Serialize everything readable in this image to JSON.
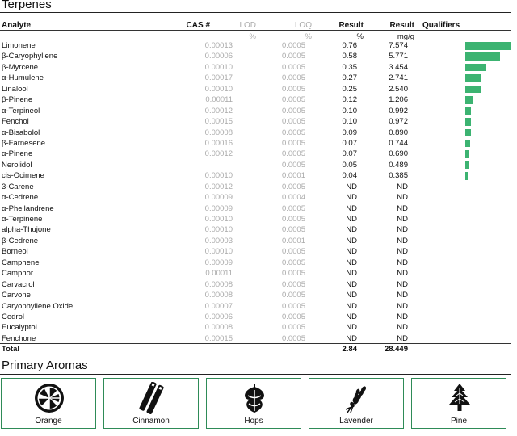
{
  "section_title": "Terpenes",
  "headers": {
    "analyte": "Analyte",
    "cas": "CAS #",
    "lod": "LOD",
    "loq": "LOQ",
    "result_pct": "Result",
    "result_mg": "Result",
    "qualifiers": "Qualifiers"
  },
  "units": {
    "lod": "%",
    "loq": "%",
    "result_pct": "%",
    "result_mg": "mg/g"
  },
  "rows": [
    {
      "name": "Limonene",
      "lod": "0.00013",
      "loq": "0.0005",
      "pct": "0.76",
      "mg": "7.574",
      "bar": 1.0
    },
    {
      "name": "β-Caryophyllene",
      "lod": "0.00006",
      "loq": "0.0005",
      "pct": "0.58",
      "mg": "5.771",
      "bar": 0.76
    },
    {
      "name": "β-Myrcene",
      "lod": "0.00010",
      "loq": "0.0005",
      "pct": "0.35",
      "mg": "3.454",
      "bar": 0.46
    },
    {
      "name": "α-Humulene",
      "lod": "0.00017",
      "loq": "0.0005",
      "pct": "0.27",
      "mg": "2.741",
      "bar": 0.36
    },
    {
      "name": "Linalool",
      "lod": "0.00010",
      "loq": "0.0005",
      "pct": "0.25",
      "mg": "2.540",
      "bar": 0.34
    },
    {
      "name": "β-Pinene",
      "lod": "0.00011",
      "loq": "0.0005",
      "pct": "0.12",
      "mg": "1.206",
      "bar": 0.16
    },
    {
      "name": "α-Terpineol",
      "lod": "0.00012",
      "loq": "0.0005",
      "pct": "0.10",
      "mg": "0.992",
      "bar": 0.13
    },
    {
      "name": "Fenchol",
      "lod": "0.00015",
      "loq": "0.0005",
      "pct": "0.10",
      "mg": "0.972",
      "bar": 0.13
    },
    {
      "name": "α-Bisabolol",
      "lod": "0.00008",
      "loq": "0.0005",
      "pct": "0.09",
      "mg": "0.890",
      "bar": 0.12
    },
    {
      "name": "β-Farnesene",
      "lod": "0.00016",
      "loq": "0.0005",
      "pct": "0.07",
      "mg": "0.744",
      "bar": 0.1
    },
    {
      "name": "α-Pinene",
      "lod": "0.00012",
      "loq": "0.0005",
      "pct": "0.07",
      "mg": "0.690",
      "bar": 0.09
    },
    {
      "name": "Nerolidol",
      "lod": "",
      "loq": "0.0005",
      "pct": "0.05",
      "mg": "0.489",
      "bar": 0.065
    },
    {
      "name": "cis-Ocimene",
      "lod": "0.00010",
      "loq": "0.0001",
      "pct": "0.04",
      "mg": "0.385",
      "bar": 0.05
    },
    {
      "name": "3-Carene",
      "lod": "0.00012",
      "loq": "0.0005",
      "pct": "ND",
      "mg": "ND",
      "bar": 0
    },
    {
      "name": "α-Cedrene",
      "lod": "0.00009",
      "loq": "0.0004",
      "pct": "ND",
      "mg": "ND",
      "bar": 0
    },
    {
      "name": "α-Phellandrene",
      "lod": "0.00009",
      "loq": "0.0005",
      "pct": "ND",
      "mg": "ND",
      "bar": 0
    },
    {
      "name": "α-Terpinene",
      "lod": "0.00010",
      "loq": "0.0005",
      "pct": "ND",
      "mg": "ND",
      "bar": 0
    },
    {
      "name": "alpha-Thujone",
      "lod": "0.00010",
      "loq": "0.0005",
      "pct": "ND",
      "mg": "ND",
      "bar": 0
    },
    {
      "name": "β-Cedrene",
      "lod": "0.00003",
      "loq": "0.0001",
      "pct": "ND",
      "mg": "ND",
      "bar": 0
    },
    {
      "name": "Borneol",
      "lod": "0.00010",
      "loq": "0.0005",
      "pct": "ND",
      "mg": "ND",
      "bar": 0
    },
    {
      "name": "Camphene",
      "lod": "0.00009",
      "loq": "0.0005",
      "pct": "ND",
      "mg": "ND",
      "bar": 0
    },
    {
      "name": "Camphor",
      "lod": "0.00011",
      "loq": "0.0005",
      "pct": "ND",
      "mg": "ND",
      "bar": 0
    },
    {
      "name": "Carvacrol",
      "lod": "0.00008",
      "loq": "0.0005",
      "pct": "ND",
      "mg": "ND",
      "bar": 0
    },
    {
      "name": "Carvone",
      "lod": "0.00008",
      "loq": "0.0005",
      "pct": "ND",
      "mg": "ND",
      "bar": 0
    },
    {
      "name": "Caryophyllene Oxide",
      "lod": "0.00007",
      "loq": "0.0005",
      "pct": "ND",
      "mg": "ND",
      "bar": 0
    },
    {
      "name": "Cedrol",
      "lod": "0.00006",
      "loq": "0.0005",
      "pct": "ND",
      "mg": "ND",
      "bar": 0
    },
    {
      "name": "Eucalyptol",
      "lod": "0.00008",
      "loq": "0.0005",
      "pct": "ND",
      "mg": "ND",
      "bar": 0
    },
    {
      "name": "Fenchone",
      "lod": "0.00015",
      "loq": "0.0005",
      "pct": "ND",
      "mg": "ND",
      "bar": 0
    }
  ],
  "total": {
    "label": "Total",
    "pct": "2.84",
    "mg": "28.449"
  },
  "aromas_title": "Primary Aromas",
  "aromas": [
    {
      "label": "Orange",
      "icon": "orange-icon"
    },
    {
      "label": "Cinnamon",
      "icon": "cinnamon-icon"
    },
    {
      "label": "Hops",
      "icon": "hops-icon"
    },
    {
      "label": "Lavender",
      "icon": "lavender-icon"
    },
    {
      "label": "Pine",
      "icon": "pine-icon"
    }
  ],
  "colors": {
    "bar": "#3cb371",
    "aroma_border": "#2e8b57",
    "muted": "#aaaaaa"
  }
}
